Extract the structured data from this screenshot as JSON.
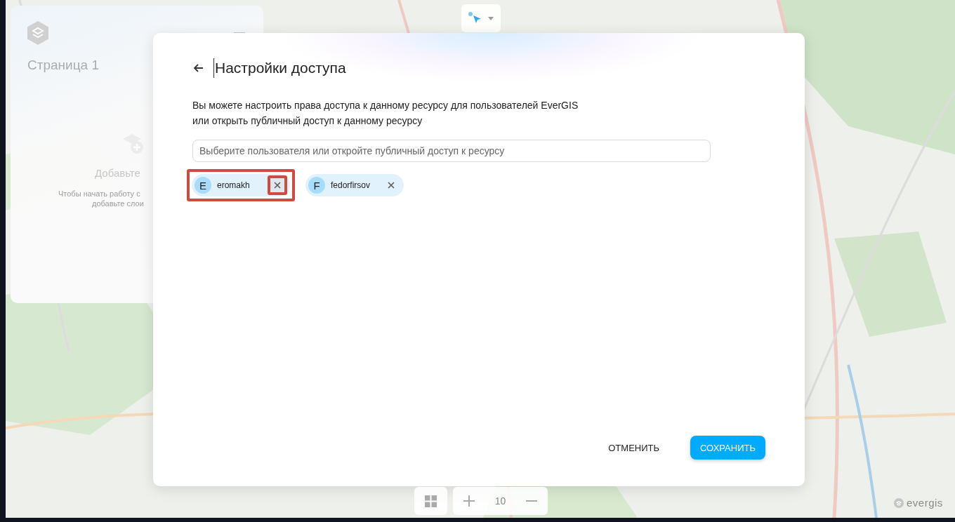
{
  "side_panel": {
    "title": "Страница 1",
    "empty_title": "Добавьте",
    "empty_hint": [
      "Чтобы начать работу с",
      "добавьте слои"
    ]
  },
  "dialog": {
    "title": "Настройки доступа",
    "description": [
      "Вы можете настроить права доступа к данному ресурсу для пользователей EverGIS",
      "или открыть публичный доступ к данному ресурсу"
    ],
    "search": {
      "placeholder": "Выберите пользователя или откройте публичный доступ к ресурсу"
    },
    "users": [
      {
        "initial": "E",
        "name": "eromakh",
        "highlighted": true
      },
      {
        "initial": "F",
        "name": "fedorfirsov",
        "highlighted": false
      }
    ],
    "buttons": [
      {
        "label": "ОТМЕНИТЬ",
        "kind": "text"
      },
      {
        "label": "СОХРАНИТЬ",
        "kind": "primary"
      }
    ]
  },
  "zoom": {
    "level": "10"
  },
  "brand": "evergis"
}
